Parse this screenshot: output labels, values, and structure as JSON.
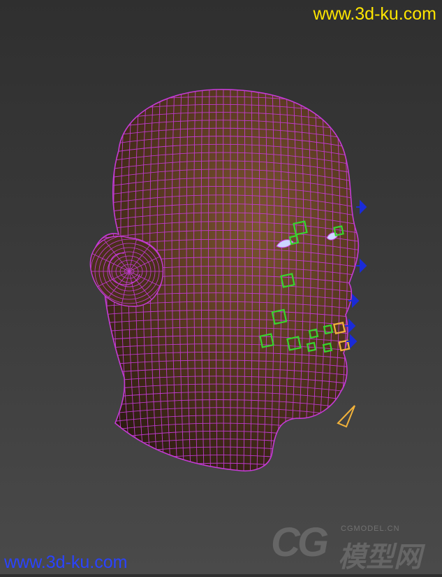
{
  "watermarks": {
    "top": "www.3d-ku.com",
    "bottom": "www.3d-ku.com",
    "brand_latin": "CG",
    "brand_small": "CGMODEL.CN",
    "brand_cn": "模型网"
  },
  "colors": {
    "mesh": "#c53bd6",
    "skin": "#5a3a22",
    "control_green": "#38d62e",
    "control_yellow": "#f2b23a",
    "control_blue": "#1a2bd8",
    "eye": "#ccd6ff"
  },
  "scene": {
    "subject": "wireframe-head-model",
    "control_icons": [
      "square-control-icon",
      "arrow-control-icon",
      "diamond-control-icon"
    ]
  }
}
